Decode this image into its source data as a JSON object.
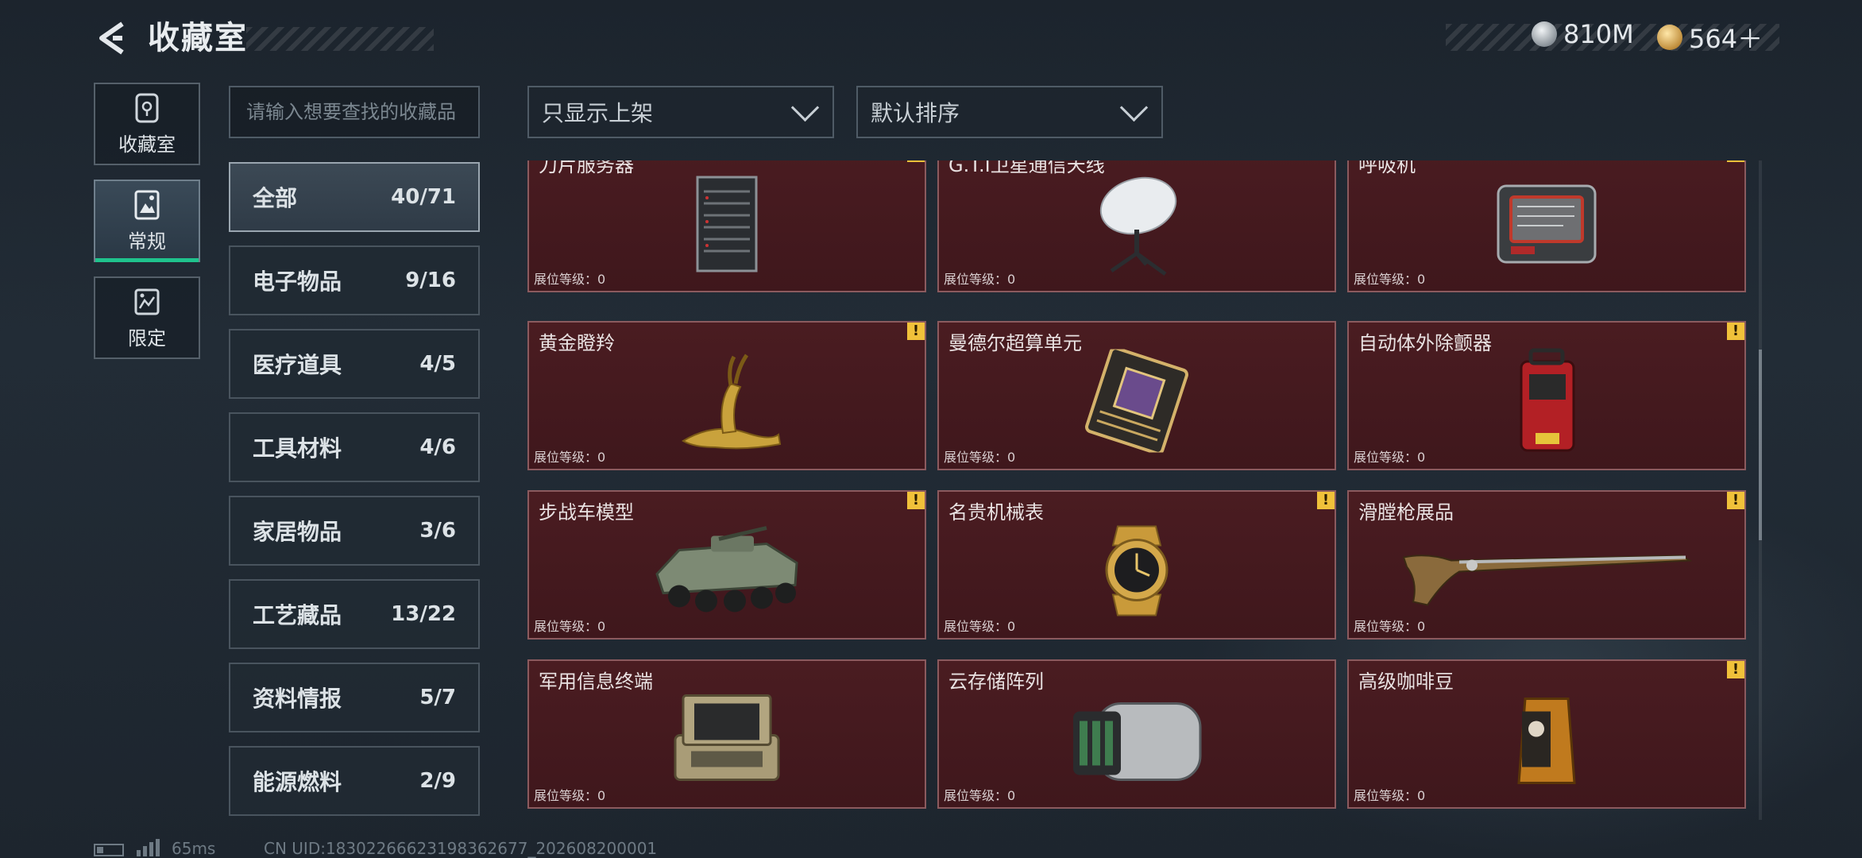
{
  "header": {
    "title": "收藏室"
  },
  "currency": {
    "silver": "810M",
    "gold": "564＋"
  },
  "side_tabs": [
    {
      "label": "收藏室",
      "icon": "vault-icon"
    },
    {
      "label": "常规",
      "icon": "picture-icon"
    },
    {
      "label": "限定",
      "icon": "limited-icon"
    }
  ],
  "search": {
    "placeholder": "请输入想要查找的收藏品"
  },
  "filters": {
    "show": "只显示上架",
    "sort": "默认排序"
  },
  "categories": [
    {
      "label": "全部",
      "count": "40/71"
    },
    {
      "label": "电子物品",
      "count": "9/16"
    },
    {
      "label": "医疗道具",
      "count": "4/5"
    },
    {
      "label": "工具材料",
      "count": "4/6"
    },
    {
      "label": "家居物品",
      "count": "3/6"
    },
    {
      "label": "工艺藏品",
      "count": "13/22"
    },
    {
      "label": "资料情报",
      "count": "5/7"
    },
    {
      "label": "能源燃料",
      "count": "2/9"
    }
  ],
  "level_label": "展位等级：0",
  "items": [
    {
      "name": "刀片服务器",
      "warn": true
    },
    {
      "name": "G.T.I卫星通信天线",
      "warn": false
    },
    {
      "name": "呼吸机",
      "warn": true
    },
    {
      "name": "黄金瞪羚",
      "warn": true
    },
    {
      "name": "曼德尔超算单元",
      "warn": false
    },
    {
      "name": "自动体外除颤器",
      "warn": true
    },
    {
      "name": "步战车模型",
      "warn": true
    },
    {
      "name": "名贵机械表",
      "warn": true
    },
    {
      "name": "滑膛枪展品",
      "warn": true
    },
    {
      "name": "军用信息终端",
      "warn": false
    },
    {
      "name": "云存储阵列",
      "warn": false
    },
    {
      "name": "高级咖啡豆",
      "warn": true
    }
  ],
  "warn_symbol": "!",
  "footer": {
    "ping": "65ms",
    "uid": "CN UID:18302266623198362677_202608200001"
  }
}
